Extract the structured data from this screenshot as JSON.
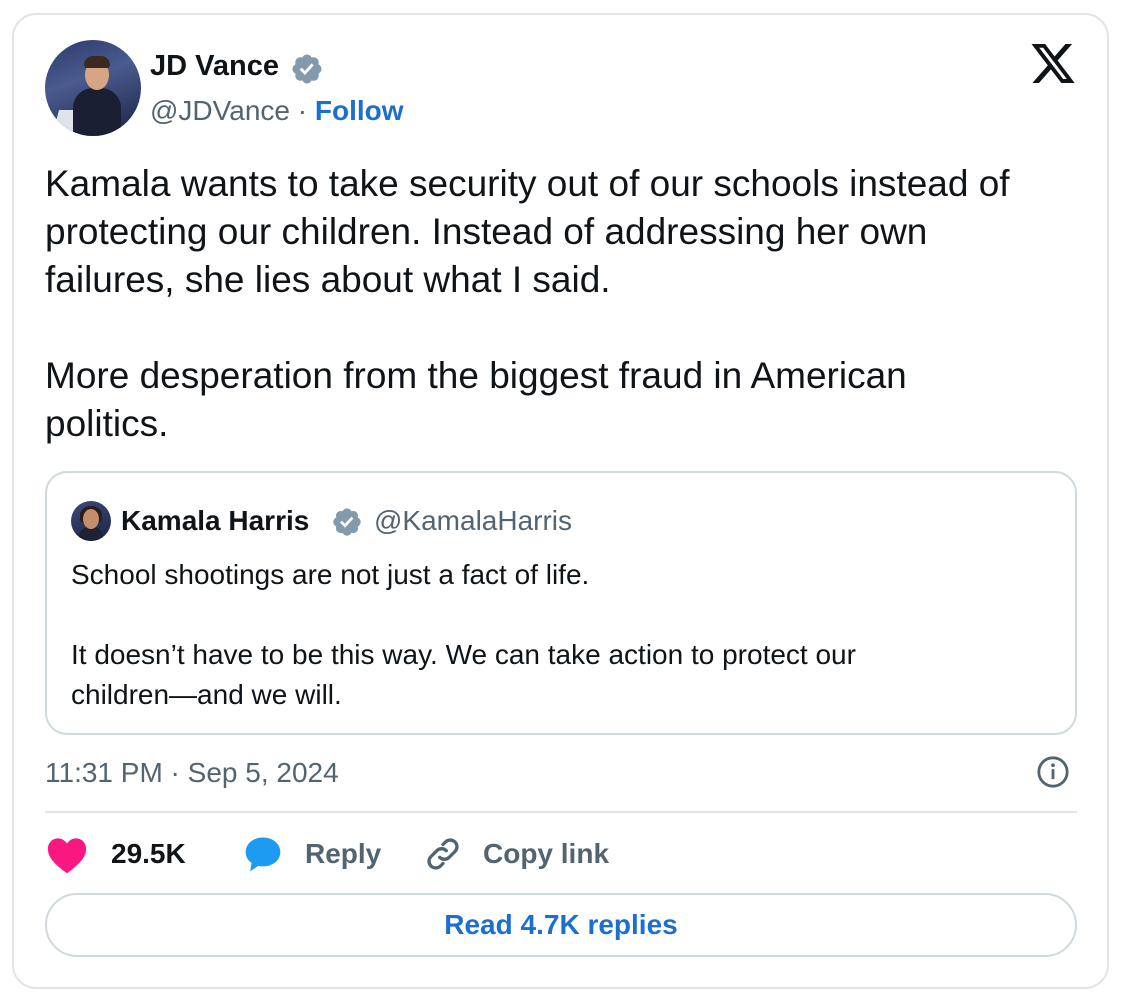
{
  "author": {
    "name": "JD Vance",
    "handle": "@JDVance",
    "separator": "·",
    "follow_label": "Follow"
  },
  "tweet": {
    "text": "Kamala wants to take security out of our schools instead of\nprotecting our children. Instead of addressing her own\nfailures, she lies about what I said.\n\nMore desperation from the biggest fraud in American\npolitics.",
    "timestamp": "11:31 PM · Sep 5, 2024"
  },
  "quoted": {
    "name": "Kamala Harris",
    "handle": "@KamalaHarris",
    "text": "School shootings are not just a fact of life.\n\nIt doesn’t have to be this way. We can take action to protect our\nchildren—and we will."
  },
  "actions": {
    "likes": "29.5K",
    "reply_label": "Reply",
    "copy_label": "Copy link",
    "read_replies_label": "Read 4.7K replies"
  },
  "colors": {
    "link_blue": "#1d6fcf",
    "like_pink": "#f91880",
    "reply_blue": "#1d9bf0",
    "verified_badge": "#829aab",
    "muted_text": "#536471"
  },
  "icons": [
    "verified-badge-icon",
    "x-logo-icon",
    "heart-icon",
    "speech-bubble-icon",
    "link-icon",
    "info-icon"
  ]
}
